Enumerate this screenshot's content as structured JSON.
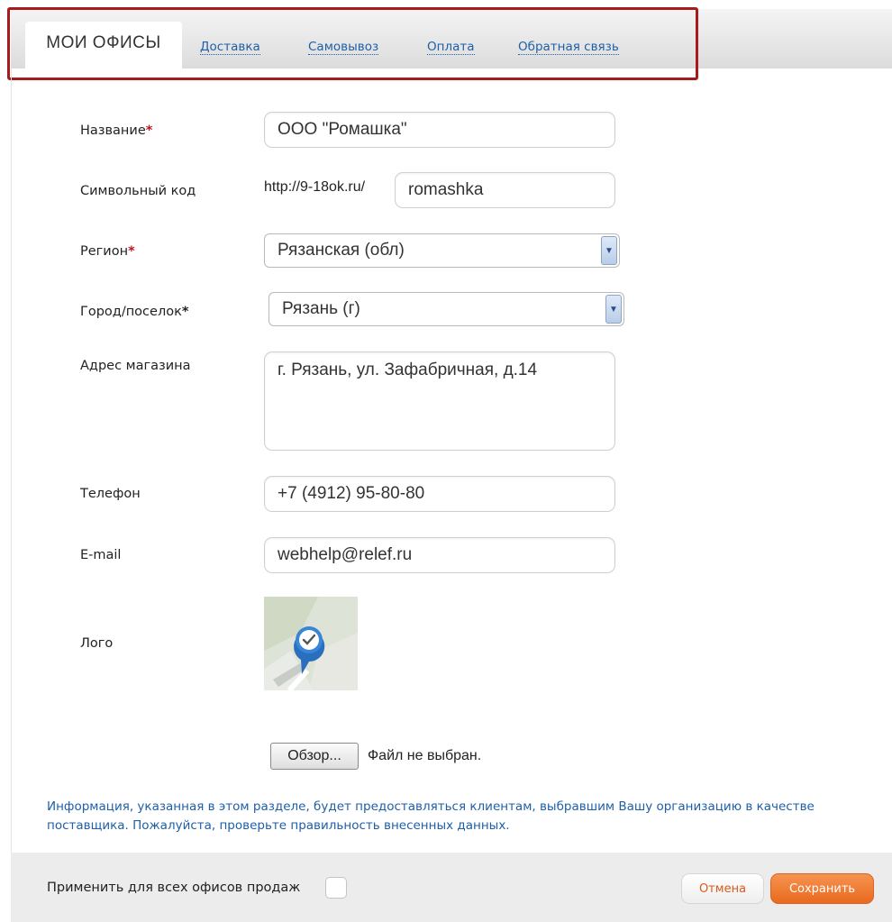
{
  "tabs": {
    "active": "МОИ ОФИСЫ",
    "links": [
      "Доставка",
      "Самовывоз",
      "Оплата",
      "Обратная связь"
    ]
  },
  "form": {
    "name_label": "Название",
    "name_value": "ООО \"Ромашка\"",
    "code_label": "Символьный код",
    "code_prefix": "http://9-18ok.ru/",
    "code_value": "romashka",
    "region_label": "Регион",
    "region_value": "Рязанская (обл)",
    "city_label": "Город/поселок",
    "city_value": "Рязань (г)",
    "address_label": "Адрес магазина",
    "address_value": "г. Рязань, ул. Зафабричная, д.14",
    "phone_label": "Телефон",
    "phone_value": "+7 (4912) 95-80-80",
    "email_label": "E-mail",
    "email_value": "webhelp@relef.ru",
    "logo_label": "Лого",
    "required_mark": "*"
  },
  "file": {
    "button": "Обзор...",
    "status": "Файл не выбран."
  },
  "info_text": "Информация, указанная в этом разделе, будет предоставляться клиентам, выбравшим Вашу организацию в качестве поставщика. Пожалуйста, проверьте правильность внесенных данных.",
  "footer": {
    "apply_label": "Применить для всех офисов продаж",
    "cancel": "Отмена",
    "save": "Сохранить"
  },
  "colors": {
    "link": "#1f5fa8",
    "required": "#c0141c",
    "highlight": "#a61c1c",
    "save_button": "#ec7530"
  },
  "icons": {
    "logo": "location-pin-check-icon",
    "select": "chevron-down-icon"
  }
}
